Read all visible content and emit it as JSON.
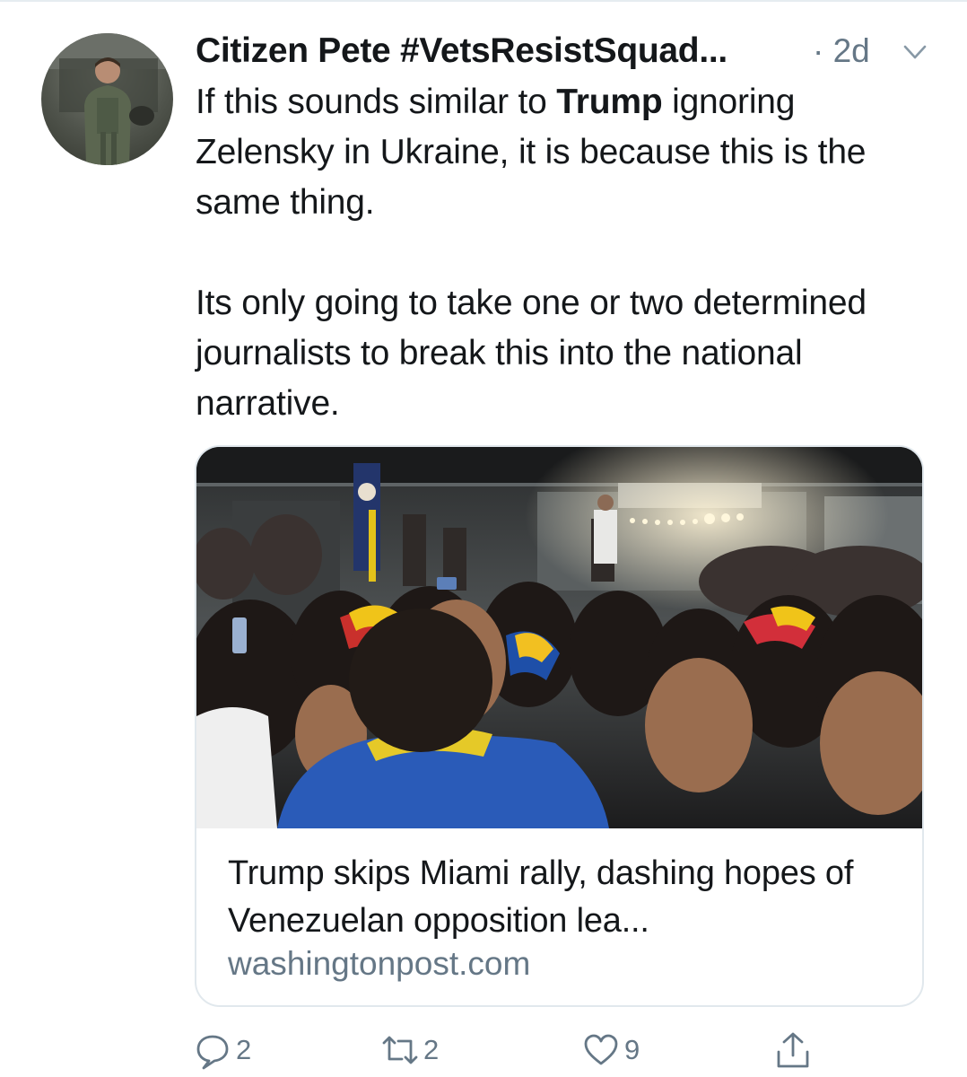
{
  "tweet": {
    "author": {
      "display_name": "Citizen Pete #VetsResistSquad...",
      "avatar_icon": "avatar-photo"
    },
    "timestamp": "· 2d",
    "menu_icon": "chevron-down-icon",
    "text": {
      "line1_before": "If this sounds similar to ",
      "line1_bold": "Trump",
      "line1_after": " ignoring Zelensky in Ukraine, it is because this is the same thing.",
      "paragraph2": "Its only going to take one or two determined journalists to break this into the national narrative."
    },
    "link_card": {
      "title": "Trump skips Miami rally, dashing hopes of Venezuelan opposition lea...",
      "domain": "washingtonpost.com"
    },
    "actions": {
      "reply_count": "2",
      "retweet_count": "2",
      "like_count": "9",
      "reply_icon": "reply-bubble-icon",
      "retweet_icon": "retweet-icon",
      "like_icon": "heart-icon",
      "share_icon": "share-icon"
    },
    "colors": {
      "text": "#14171a",
      "secondary": "#657786",
      "border": "#e1e8ed"
    }
  }
}
